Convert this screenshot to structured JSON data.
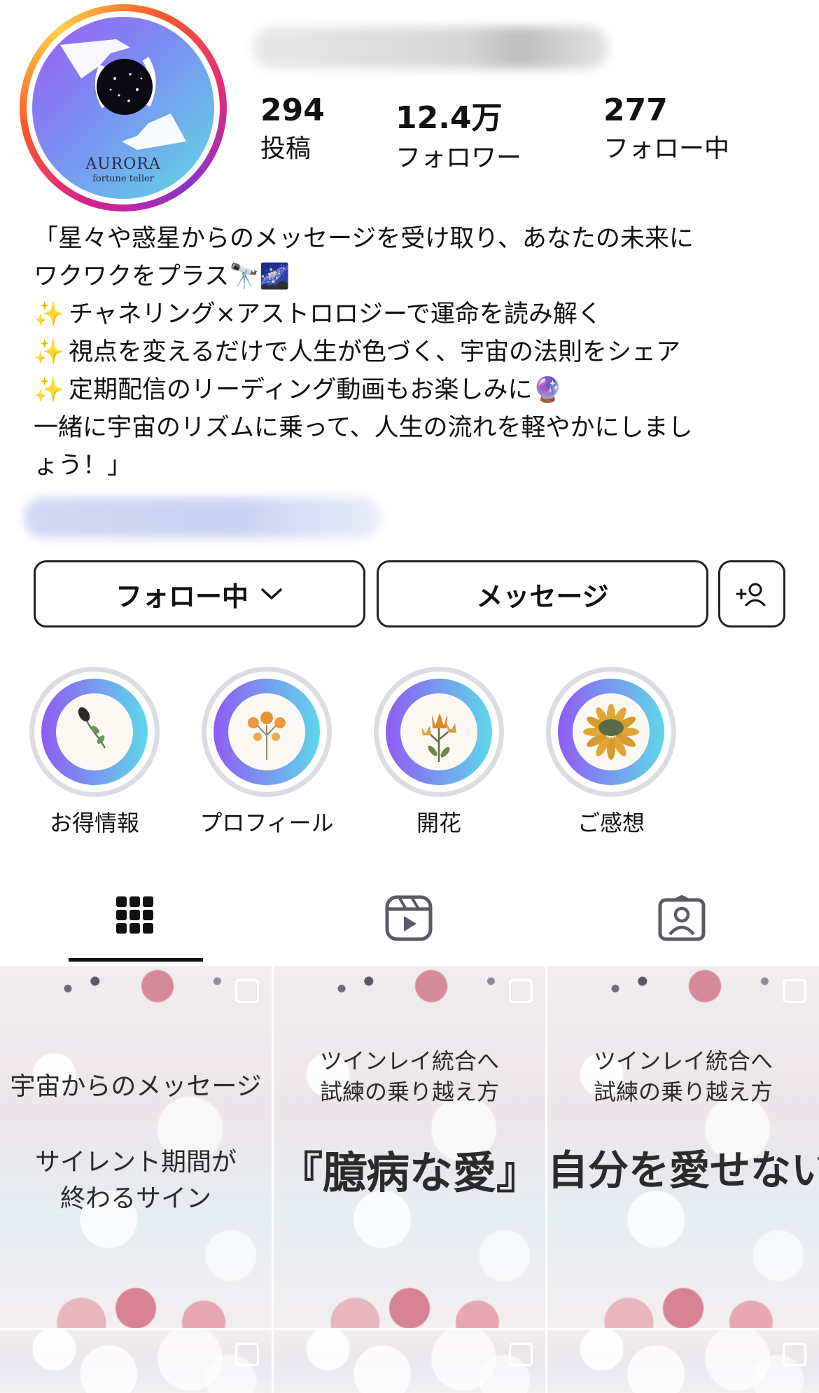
{
  "profile": {
    "avatar_brand": "AURORA",
    "avatar_sub": "fortune teller"
  },
  "stats": [
    {
      "value": "294",
      "label": "投稿"
    },
    {
      "value": "12.4万",
      "label": "フォロワー"
    },
    {
      "value": "277",
      "label": "フォロー中"
    }
  ],
  "bio": {
    "line1": "「星々や惑星からのメッセージを受け取り、あなたの未来に",
    "line2": "ワクワクをプラス🔭🌌",
    "line3": "チャネリング×アストロロジーで運命を読み解く",
    "line4": "視点を変えるだけで人生が色づく、宇宙の法則をシェア",
    "line5": "定期配信のリーディング動画もお楽しみに🔮",
    "line6": "一緒に宇宙のリズムに乗って、人生の流れを軽やかにしまし",
    "line7": "ょう！」",
    "sparkle": "✨"
  },
  "actions": {
    "following_label": "フォロー中",
    "message_label": "メッセージ",
    "add_user_glyph": "+"
  },
  "highlights": [
    {
      "label": "お得情報"
    },
    {
      "label": "プロフィール"
    },
    {
      "label": "開花"
    },
    {
      "label": "ご感想"
    }
  ],
  "posts": [
    {
      "top": "宇宙からのメッセージ",
      "main1": "サイレント期間が",
      "main2": "終わるサイン"
    },
    {
      "top1": "ツインレイ統合へ",
      "top2": "試練の乗り越え方",
      "main": "『臆病な愛』"
    },
    {
      "top1": "ツインレイ統合へ",
      "top2": "試練の乗り越え方",
      "main": "自分を愛せない"
    }
  ],
  "colors": {
    "avatar_ring": "#d81f8f",
    "highlight_gradient_start": "#8f5cf5",
    "highlight_gradient_end": "#5ed8e8",
    "tab_icon": "#5b5b66"
  },
  "icons": {
    "grid": "grid-icon",
    "reels": "reels-icon",
    "tagged": "tagged-icon",
    "chevron": "chevron-down-icon",
    "add_user": "add-user-icon"
  }
}
